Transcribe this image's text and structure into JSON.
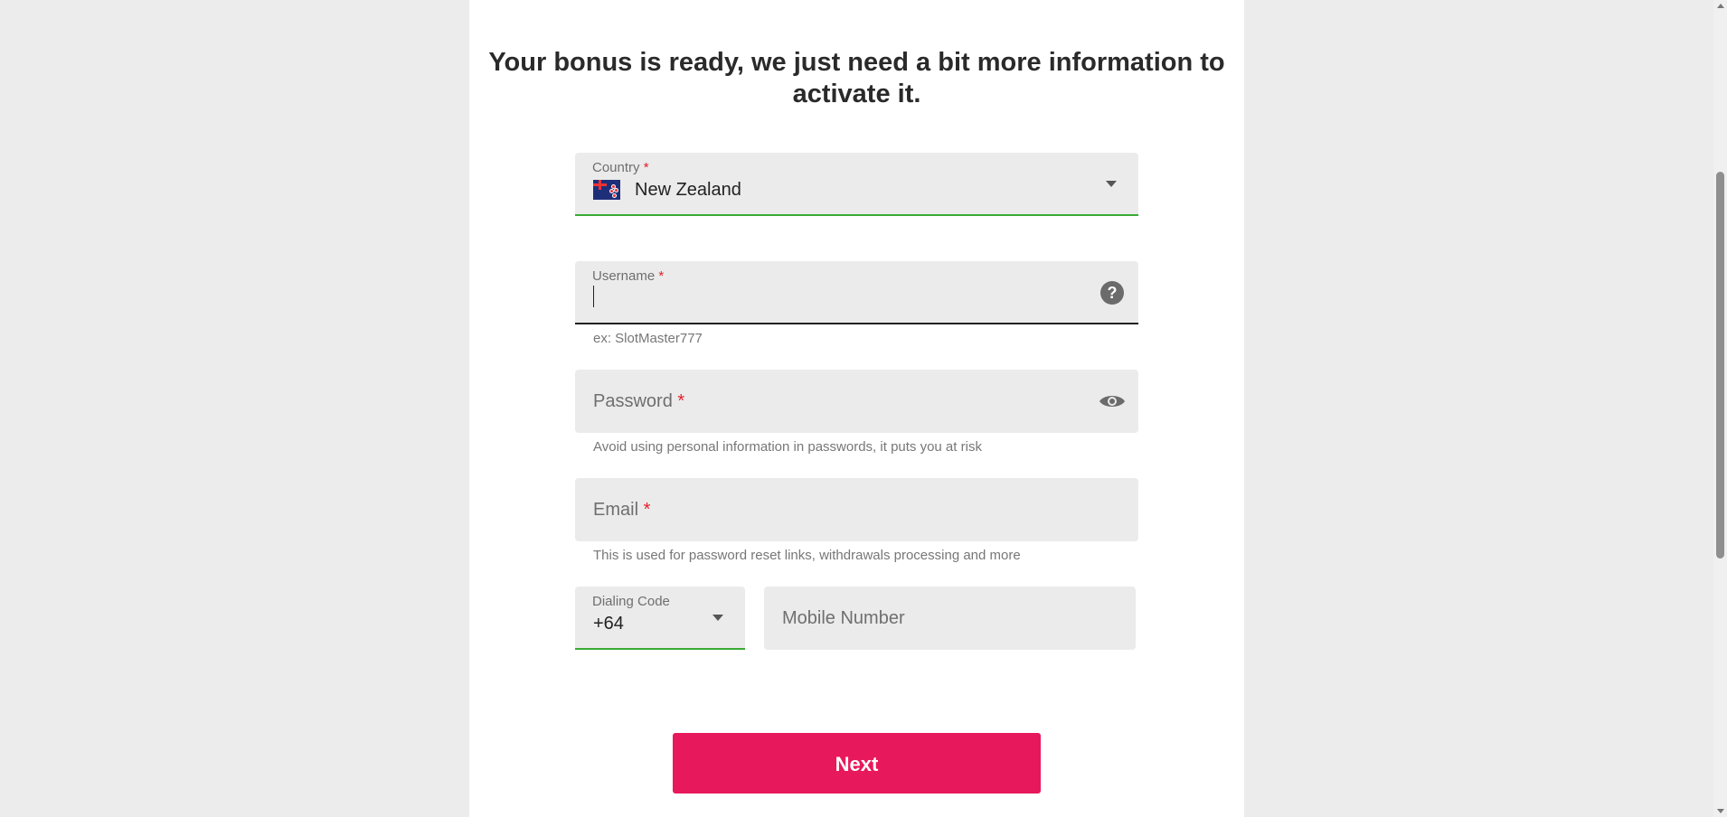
{
  "headline": "Your bonus is ready, we just need a bit more information to activate it.",
  "country": {
    "label": "Country",
    "required_mark": "*",
    "value": "New Zealand",
    "flag_icon": "new-zealand-flag-icon"
  },
  "username": {
    "label": "Username",
    "required_mark": "*",
    "value": "",
    "hint": "ex: SlotMaster777",
    "help_icon": "?"
  },
  "password": {
    "label": "Password",
    "required_mark": "*",
    "hint": "Avoid using personal information in passwords, it puts you at risk"
  },
  "email": {
    "label": "Email",
    "required_mark": "*",
    "hint": "This is used for password reset links, withdrawals processing and more"
  },
  "dialing_code": {
    "label": "Dialing Code",
    "value": "+64"
  },
  "mobile": {
    "label": "Mobile Number"
  },
  "next_button": "Next",
  "colors": {
    "accent": "#e8185c",
    "valid": "#3aaa35",
    "required": "#e0222c",
    "field_bg": "#ebebeb",
    "page_bg": "#ececec"
  }
}
